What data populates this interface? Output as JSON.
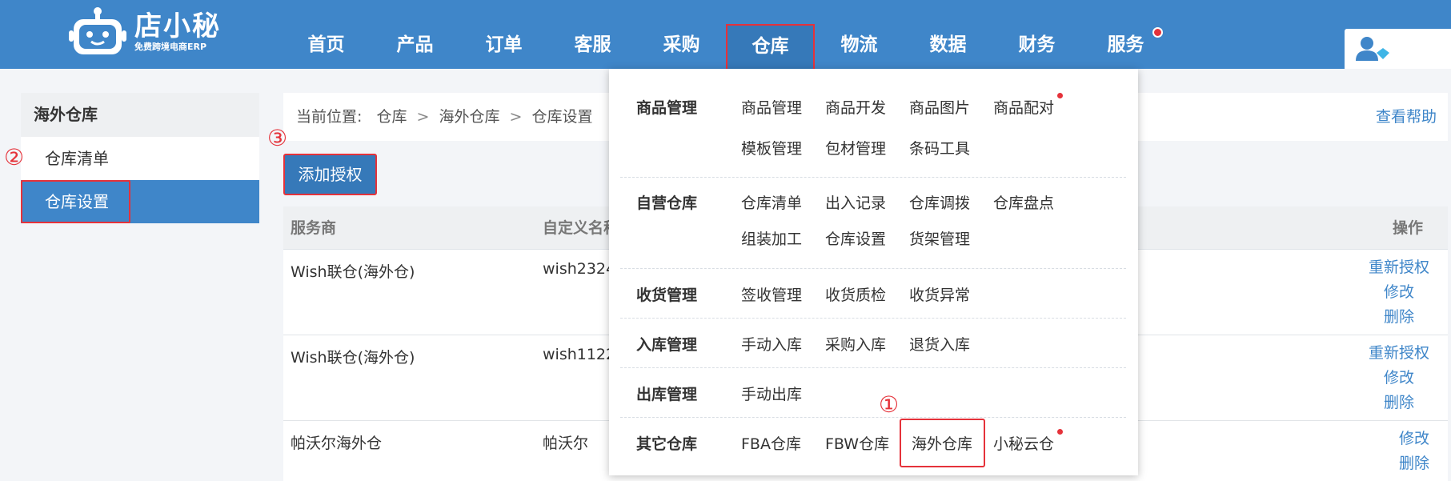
{
  "logo": {
    "name": "店小秘",
    "tagline": "免费跨境电商ERP"
  },
  "nav": {
    "items": [
      {
        "label": "首页"
      },
      {
        "label": "产品"
      },
      {
        "label": "订单"
      },
      {
        "label": "客服"
      },
      {
        "label": "采购"
      },
      {
        "label": "仓库",
        "active": true
      },
      {
        "label": "物流"
      },
      {
        "label": "数据"
      },
      {
        "label": "财务"
      },
      {
        "label": "服务"
      }
    ],
    "notification_color": "#e5323a"
  },
  "sidebar": {
    "heading": "海外仓库",
    "items": [
      {
        "label": "仓库清单"
      },
      {
        "label": "仓库设置",
        "active": true
      }
    ]
  },
  "breadcrumb": {
    "prefix": "当前位置:",
    "path": [
      "仓库",
      "海外仓库",
      "仓库设置"
    ],
    "separator": ">",
    "help": "查看帮助"
  },
  "toolbar": {
    "add_label": "添加授权"
  },
  "table": {
    "headers": {
      "provider": "服务商",
      "custom_name": "自定义名称",
      "actions": "操作"
    },
    "rows": [
      {
        "provider": "Wish联仓(海外仓)",
        "custom_name": "wish2324",
        "actions": [
          "重新授权",
          "修改",
          "删除"
        ]
      },
      {
        "provider": "Wish联仓(海外仓)",
        "custom_name": "wish1122",
        "actions": [
          "重新授权",
          "修改",
          "删除"
        ]
      },
      {
        "provider": "帕沃尔海外仓",
        "custom_name": "帕沃尔",
        "actions": [
          "修改",
          "删除"
        ]
      }
    ]
  },
  "dropdown": {
    "groups": [
      {
        "title": "商品管理",
        "links": [
          "商品管理",
          "商品开发",
          "商品图片",
          "商品配对",
          "模板管理",
          "包材管理",
          "条码工具"
        ]
      },
      {
        "title": "自营仓库",
        "links": [
          "仓库清单",
          "出入记录",
          "仓库调拨",
          "仓库盘点",
          "组装加工",
          "仓库设置",
          "货架管理"
        ]
      },
      {
        "title": "收货管理",
        "links": [
          "签收管理",
          "收货质检",
          "收货异常"
        ]
      },
      {
        "title": "入库管理",
        "links": [
          "手动入库",
          "采购入库",
          "退货入库"
        ]
      },
      {
        "title": "出库管理",
        "links": [
          "手动出库"
        ]
      },
      {
        "title": "其它仓库",
        "links": [
          "FBA仓库",
          "FBW仓库",
          "海外仓库",
          "小秘云仓"
        ]
      }
    ]
  },
  "annotations": {
    "step1": "①",
    "step2": "②",
    "step3": "③"
  },
  "colors": {
    "primary": "#3f86c9",
    "highlight": "#e5323a",
    "link": "#3f86c9"
  }
}
